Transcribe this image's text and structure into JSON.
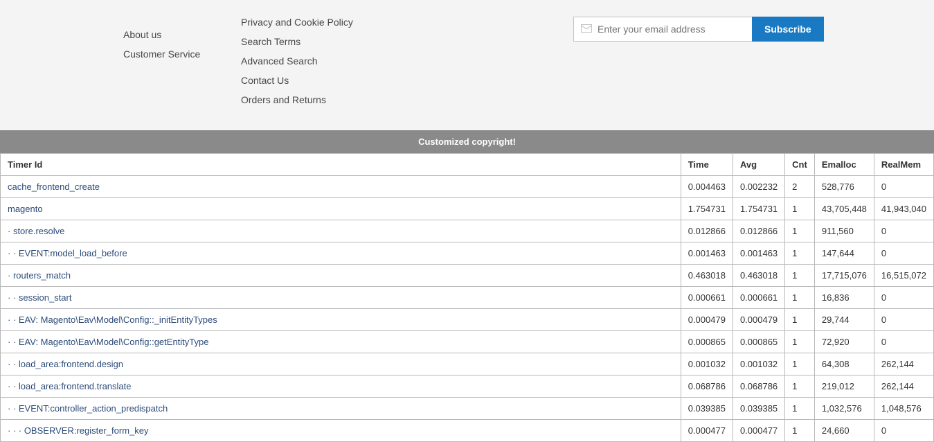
{
  "footer": {
    "col1": [
      {
        "label": "About us"
      },
      {
        "label": "Customer Service"
      }
    ],
    "col2": [
      {
        "label": "Privacy and Cookie Policy"
      },
      {
        "label": "Search Terms"
      },
      {
        "label": "Advanced Search"
      },
      {
        "label": "Contact Us"
      },
      {
        "label": "Orders and Returns"
      }
    ],
    "newsletter": {
      "placeholder": "Enter your email address",
      "subscribe_label": "Subscribe"
    },
    "copyright": "Customized copyright!"
  },
  "profiler": {
    "headers": [
      "Timer Id",
      "Time",
      "Avg",
      "Cnt",
      "Emalloc",
      "RealMem"
    ],
    "rows": [
      {
        "id": "cache_frontend_create",
        "time": "0.004463",
        "avg": "0.002232",
        "cnt": "2",
        "emalloc": "528,776",
        "realmem": "0"
      },
      {
        "id": "magento",
        "time": "1.754731",
        "avg": "1.754731",
        "cnt": "1",
        "emalloc": "43,705,448",
        "realmem": "41,943,040"
      },
      {
        "id": "·  store.resolve",
        "time": "0.012866",
        "avg": "0.012866",
        "cnt": "1",
        "emalloc": "911,560",
        "realmem": "0"
      },
      {
        "id": "·  ·  EVENT:model_load_before",
        "time": "0.001463",
        "avg": "0.001463",
        "cnt": "1",
        "emalloc": "147,644",
        "realmem": "0"
      },
      {
        "id": "·  routers_match",
        "time": "0.463018",
        "avg": "0.463018",
        "cnt": "1",
        "emalloc": "17,715,076",
        "realmem": "16,515,072"
      },
      {
        "id": "·  ·  session_start",
        "time": "0.000661",
        "avg": "0.000661",
        "cnt": "1",
        "emalloc": "16,836",
        "realmem": "0"
      },
      {
        "id": "·  ·  EAV: Magento\\Eav\\Model\\Config::_initEntityTypes",
        "time": "0.000479",
        "avg": "0.000479",
        "cnt": "1",
        "emalloc": "29,744",
        "realmem": "0"
      },
      {
        "id": "·  ·  EAV: Magento\\Eav\\Model\\Config::getEntityType",
        "time": "0.000865",
        "avg": "0.000865",
        "cnt": "1",
        "emalloc": "72,920",
        "realmem": "0"
      },
      {
        "id": "·  ·  load_area:frontend.design",
        "time": "0.001032",
        "avg": "0.001032",
        "cnt": "1",
        "emalloc": "64,308",
        "realmem": "262,144"
      },
      {
        "id": "·  ·  load_area:frontend.translate",
        "time": "0.068786",
        "avg": "0.068786",
        "cnt": "1",
        "emalloc": "219,012",
        "realmem": "262,144"
      },
      {
        "id": "·  ·  EVENT:controller_action_predispatch",
        "time": "0.039385",
        "avg": "0.039385",
        "cnt": "1",
        "emalloc": "1,032,576",
        "realmem": "1,048,576"
      },
      {
        "id": "·  ·  ·  OBSERVER:register_form_key",
        "time": "0.000477",
        "avg": "0.000477",
        "cnt": "1",
        "emalloc": "24,660",
        "realmem": "0"
      }
    ]
  }
}
